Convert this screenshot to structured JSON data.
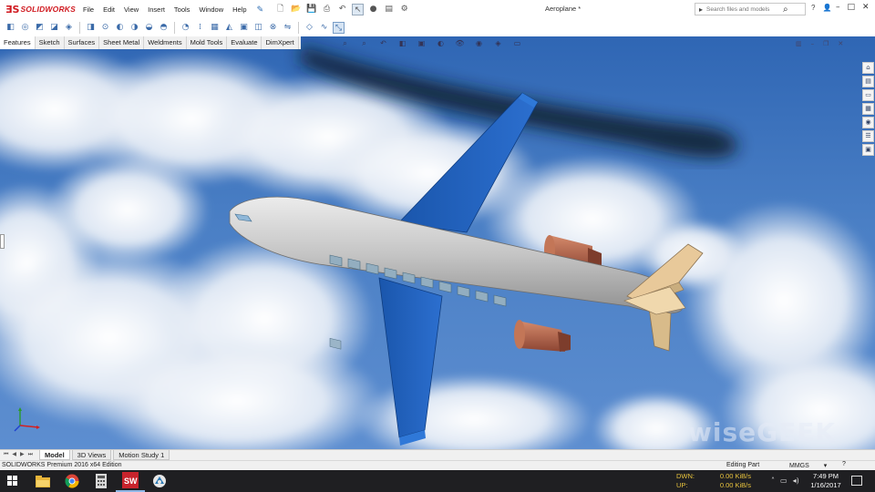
{
  "app": {
    "logo_text": "SOLIDWORKS",
    "logo_mark": "ƎS",
    "document_title": "Aeroplane *"
  },
  "menu": [
    "File",
    "Edit",
    "View",
    "Insert",
    "Tools",
    "Window",
    "Help"
  ],
  "search": {
    "placeholder": "Search files and models"
  },
  "help": {
    "question_label": "?"
  },
  "command_tabs": [
    "Features",
    "Sketch",
    "Surfaces",
    "Sheet Metal",
    "Weldments",
    "Mold Tools",
    "Evaluate",
    "DimXpert"
  ],
  "active_command_tab": "Features",
  "model_tabs": [
    "Model",
    "3D Views",
    "Motion Study 1"
  ],
  "active_model_tab": "Model",
  "status": {
    "product": "SOLIDWORKS Premium 2016 x64 Edition",
    "mode": "Editing Part",
    "units": "MMGS",
    "units_arrow": "▾",
    "help_icon": "?"
  },
  "watermark": "wiseGEEK",
  "taskbar": {
    "network": [
      {
        "label": "DWN:",
        "value": "0.00 KiB/s"
      },
      {
        "label": "UP:",
        "value": "0.00 KiB/s"
      }
    ],
    "time": "7:49 PM",
    "date": "1/16/2017",
    "apps": [
      "file-explorer-icon",
      "chrome-icon",
      "calculator-icon",
      "solidworks-icon",
      "app-icon"
    ]
  },
  "colors": {
    "accent": "#d0191f",
    "wing": "#1e5fb8",
    "fuselage": "#c9c9c9",
    "engine": "#b8654a",
    "tail": "#e8c99a",
    "sky": "#3a6fb7"
  }
}
